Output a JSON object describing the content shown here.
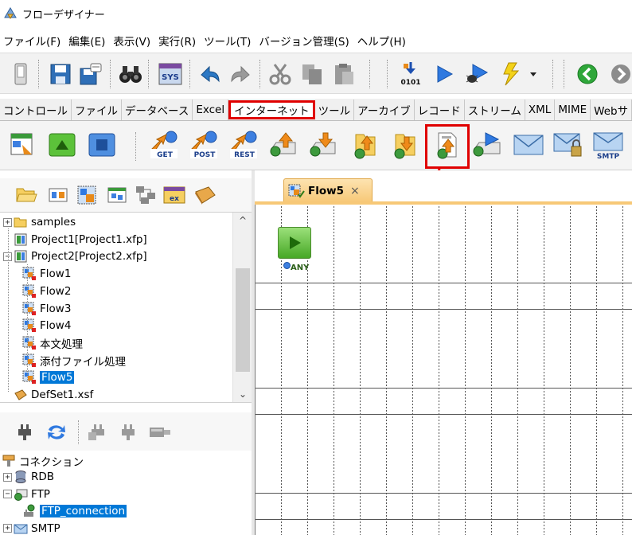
{
  "window": {
    "title": "フローデザイナー"
  },
  "menu": [
    "ファイル(F)",
    "編集(E)",
    "表示(V)",
    "実行(R)",
    "ツール(T)",
    "バージョン管理(S)",
    "ヘルプ(H)"
  ],
  "tabs": [
    "コントロール",
    "ファイル",
    "データベース",
    "Excel",
    "インターネット",
    "ツール",
    "アーカイブ",
    "レコード",
    "ストリーム",
    "XML",
    "MIME",
    "Webサ"
  ],
  "active_tab_index": 4,
  "net_toolbar": {
    "get_label": "GET",
    "post_label": "POST",
    "rest_label": "REST",
    "smtp_label": "SMTP"
  },
  "main_toolbar": {
    "bin_label": "0101",
    "sys_label": "SYS"
  },
  "project_tree": {
    "items": [
      {
        "label": "samples",
        "level": 0,
        "icon": "folder-icon",
        "expander": "+"
      },
      {
        "label": "Project1[Project1.xfp]",
        "level": 0,
        "icon": "project-icon",
        "expander": ""
      },
      {
        "label": "Project2[Project2.xfp]",
        "level": 0,
        "icon": "project-icon",
        "expander": "−"
      },
      {
        "label": "Flow1",
        "level": 1,
        "icon": "flow-icon",
        "expander": ""
      },
      {
        "label": "Flow2",
        "level": 1,
        "icon": "flow-icon",
        "expander": ""
      },
      {
        "label": "Flow3",
        "level": 1,
        "icon": "flow-icon",
        "expander": ""
      },
      {
        "label": "Flow4",
        "level": 1,
        "icon": "flow-icon",
        "expander": ""
      },
      {
        "label": "本文処理",
        "level": 1,
        "icon": "flow-icon",
        "expander": ""
      },
      {
        "label": "添付ファイル処理",
        "level": 1,
        "icon": "flow-icon",
        "expander": ""
      },
      {
        "label": "Flow5",
        "level": 1,
        "icon": "flow-icon",
        "expander": "",
        "selected": true
      },
      {
        "label": "DefSet1.xsf",
        "level": 0,
        "icon": "defset-icon",
        "expander": ""
      }
    ]
  },
  "connection_tree": {
    "root": "コネクション",
    "items": [
      {
        "label": "RDB",
        "level": 0,
        "icon": "database-icon",
        "expander": "+"
      },
      {
        "label": "FTP",
        "level": 0,
        "icon": "ftp-icon",
        "expander": "−"
      },
      {
        "label": "FTP_connection",
        "level": 1,
        "icon": "ftp-connection-icon",
        "expander": "",
        "selected": true
      },
      {
        "label": "SMTP",
        "level": 0,
        "icon": "mail-icon",
        "expander": "+"
      }
    ]
  },
  "editor": {
    "tab_label": "Flow5",
    "close_glyph": "×",
    "start_node_port": "ANY"
  },
  "colors": {
    "highlight": "#e00000",
    "selection": "#0078d7",
    "tab_accent": "#f7c877"
  }
}
